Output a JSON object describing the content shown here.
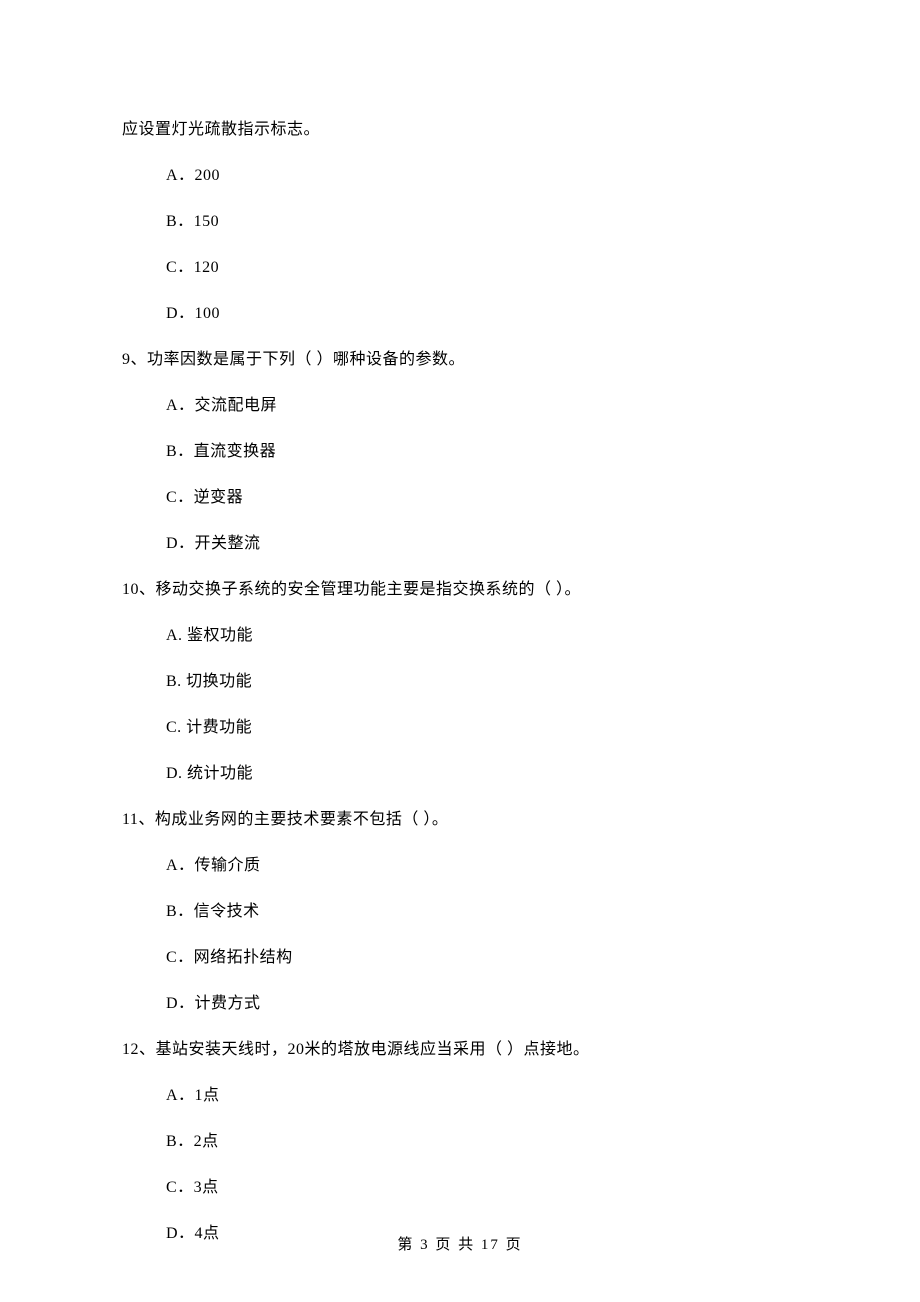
{
  "continuation": "应设置灯光疏散指示标志。",
  "q8": {
    "options": {
      "a": "A．200",
      "b": "B．150",
      "c": "C．120",
      "d": "D．100"
    }
  },
  "q9": {
    "text": "9、功率因数是属于下列（    ）哪种设备的参数。",
    "options": {
      "a": "A．交流配电屏",
      "b": "B．直流变换器",
      "c": "C．逆变器",
      "d": "D．开关整流"
    }
  },
  "q10": {
    "text": "10、移动交换子系统的安全管理功能主要是指交换系统的（    ）。",
    "options": {
      "a": "A. 鉴权功能",
      "b": "B. 切换功能",
      "c": "C. 计费功能",
      "d": "D. 统计功能"
    }
  },
  "q11": {
    "text": "11、构成业务网的主要技术要素不包括（    ）。",
    "options": {
      "a": "A．传输介质",
      "b": "B．信令技术",
      "c": "C．网络拓扑结构",
      "d": "D．计费方式"
    }
  },
  "q12": {
    "text": "12、基站安装天线时，20米的塔放电源线应当采用（    ）点接地。",
    "options": {
      "a": "A．1点",
      "b": "B．2点",
      "c": "C．3点",
      "d": "D．4点"
    }
  },
  "footer": "第 3 页 共 17 页"
}
